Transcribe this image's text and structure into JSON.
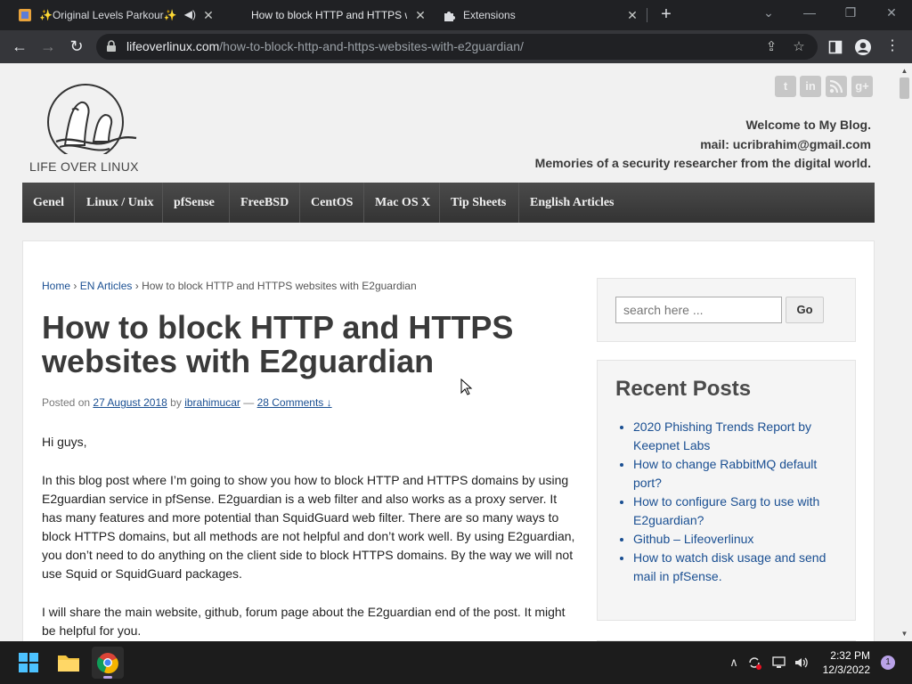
{
  "browser": {
    "tabs": [
      {
        "title": "✨Original Levels Parkour✨",
        "active": false
      },
      {
        "title": "How to block HTTP and HTTPS w",
        "active": true
      },
      {
        "title": "Extensions",
        "active": false
      }
    ],
    "url_host": "lifeoverlinux.com",
    "url_path": "/how-to-block-http-and-https-websites-with-e2guardian/"
  },
  "site": {
    "logo_text": "LIFE OVER LINUX",
    "welcome": "Welcome to My Blog.",
    "mail": "mail: ucribrahim@gmail.com",
    "tagline": "Memories of a security researcher from the digital world.",
    "social_icons": [
      "twitter-icon",
      "linkedin-icon",
      "rss-icon",
      "google-plus-icon"
    ],
    "menu": [
      "Genel",
      "Linux / Unix",
      "pfSense",
      "FreeBSD",
      "CentOS",
      "Mac OS X",
      "Tip Sheets",
      "English Articles"
    ]
  },
  "article": {
    "breadcrumb": {
      "home": "Home",
      "section": "EN Articles",
      "current": "How to block HTTP and HTTPS websites with E2guardian",
      "sep": "›"
    },
    "title": "How to block HTTP and HTTPS websites with E2guardian",
    "meta": {
      "posted_on": "Posted on",
      "date": "27 August 2018",
      "by": "by",
      "author": "ibrahimucar",
      "dash": "—",
      "comments": "28 Comments ↓"
    },
    "paragraphs": [
      "Hi guys,",
      "In this blog post where I’m going to show you how to block HTTP and HTTPS domains by using E2guardian service in pfSense. E2guardian is a web filter and also works as a proxy server. It has many features and more potential than SquidGuard web filter. There are so many ways to block HTTPS domains, but all methods are not helpful and don’t work well. By using E2guardian, you don’t need to do anything on the client side to block HTTPS domains. By the way we will not use Squid or SquidGuard packages.",
      "I will share the main website, github, forum page about the E2guardian end of the post. It might be helpful for you."
    ]
  },
  "sidebar": {
    "search_placeholder": "search here ...",
    "search_button": "Go",
    "recent_title": "Recent Posts",
    "recent_posts": [
      "2020 Phishing Trends Report by Keepnet Labs",
      "How to change RabbitMQ default port?",
      "How to configure Sarg to use with E2guardian?",
      "Github – Lifeoverlinux",
      "How to watch disk usage and send mail in pfSense."
    ]
  },
  "taskbar": {
    "time": "2:32 PM",
    "date": "12/3/2022",
    "notification_count": "1"
  }
}
